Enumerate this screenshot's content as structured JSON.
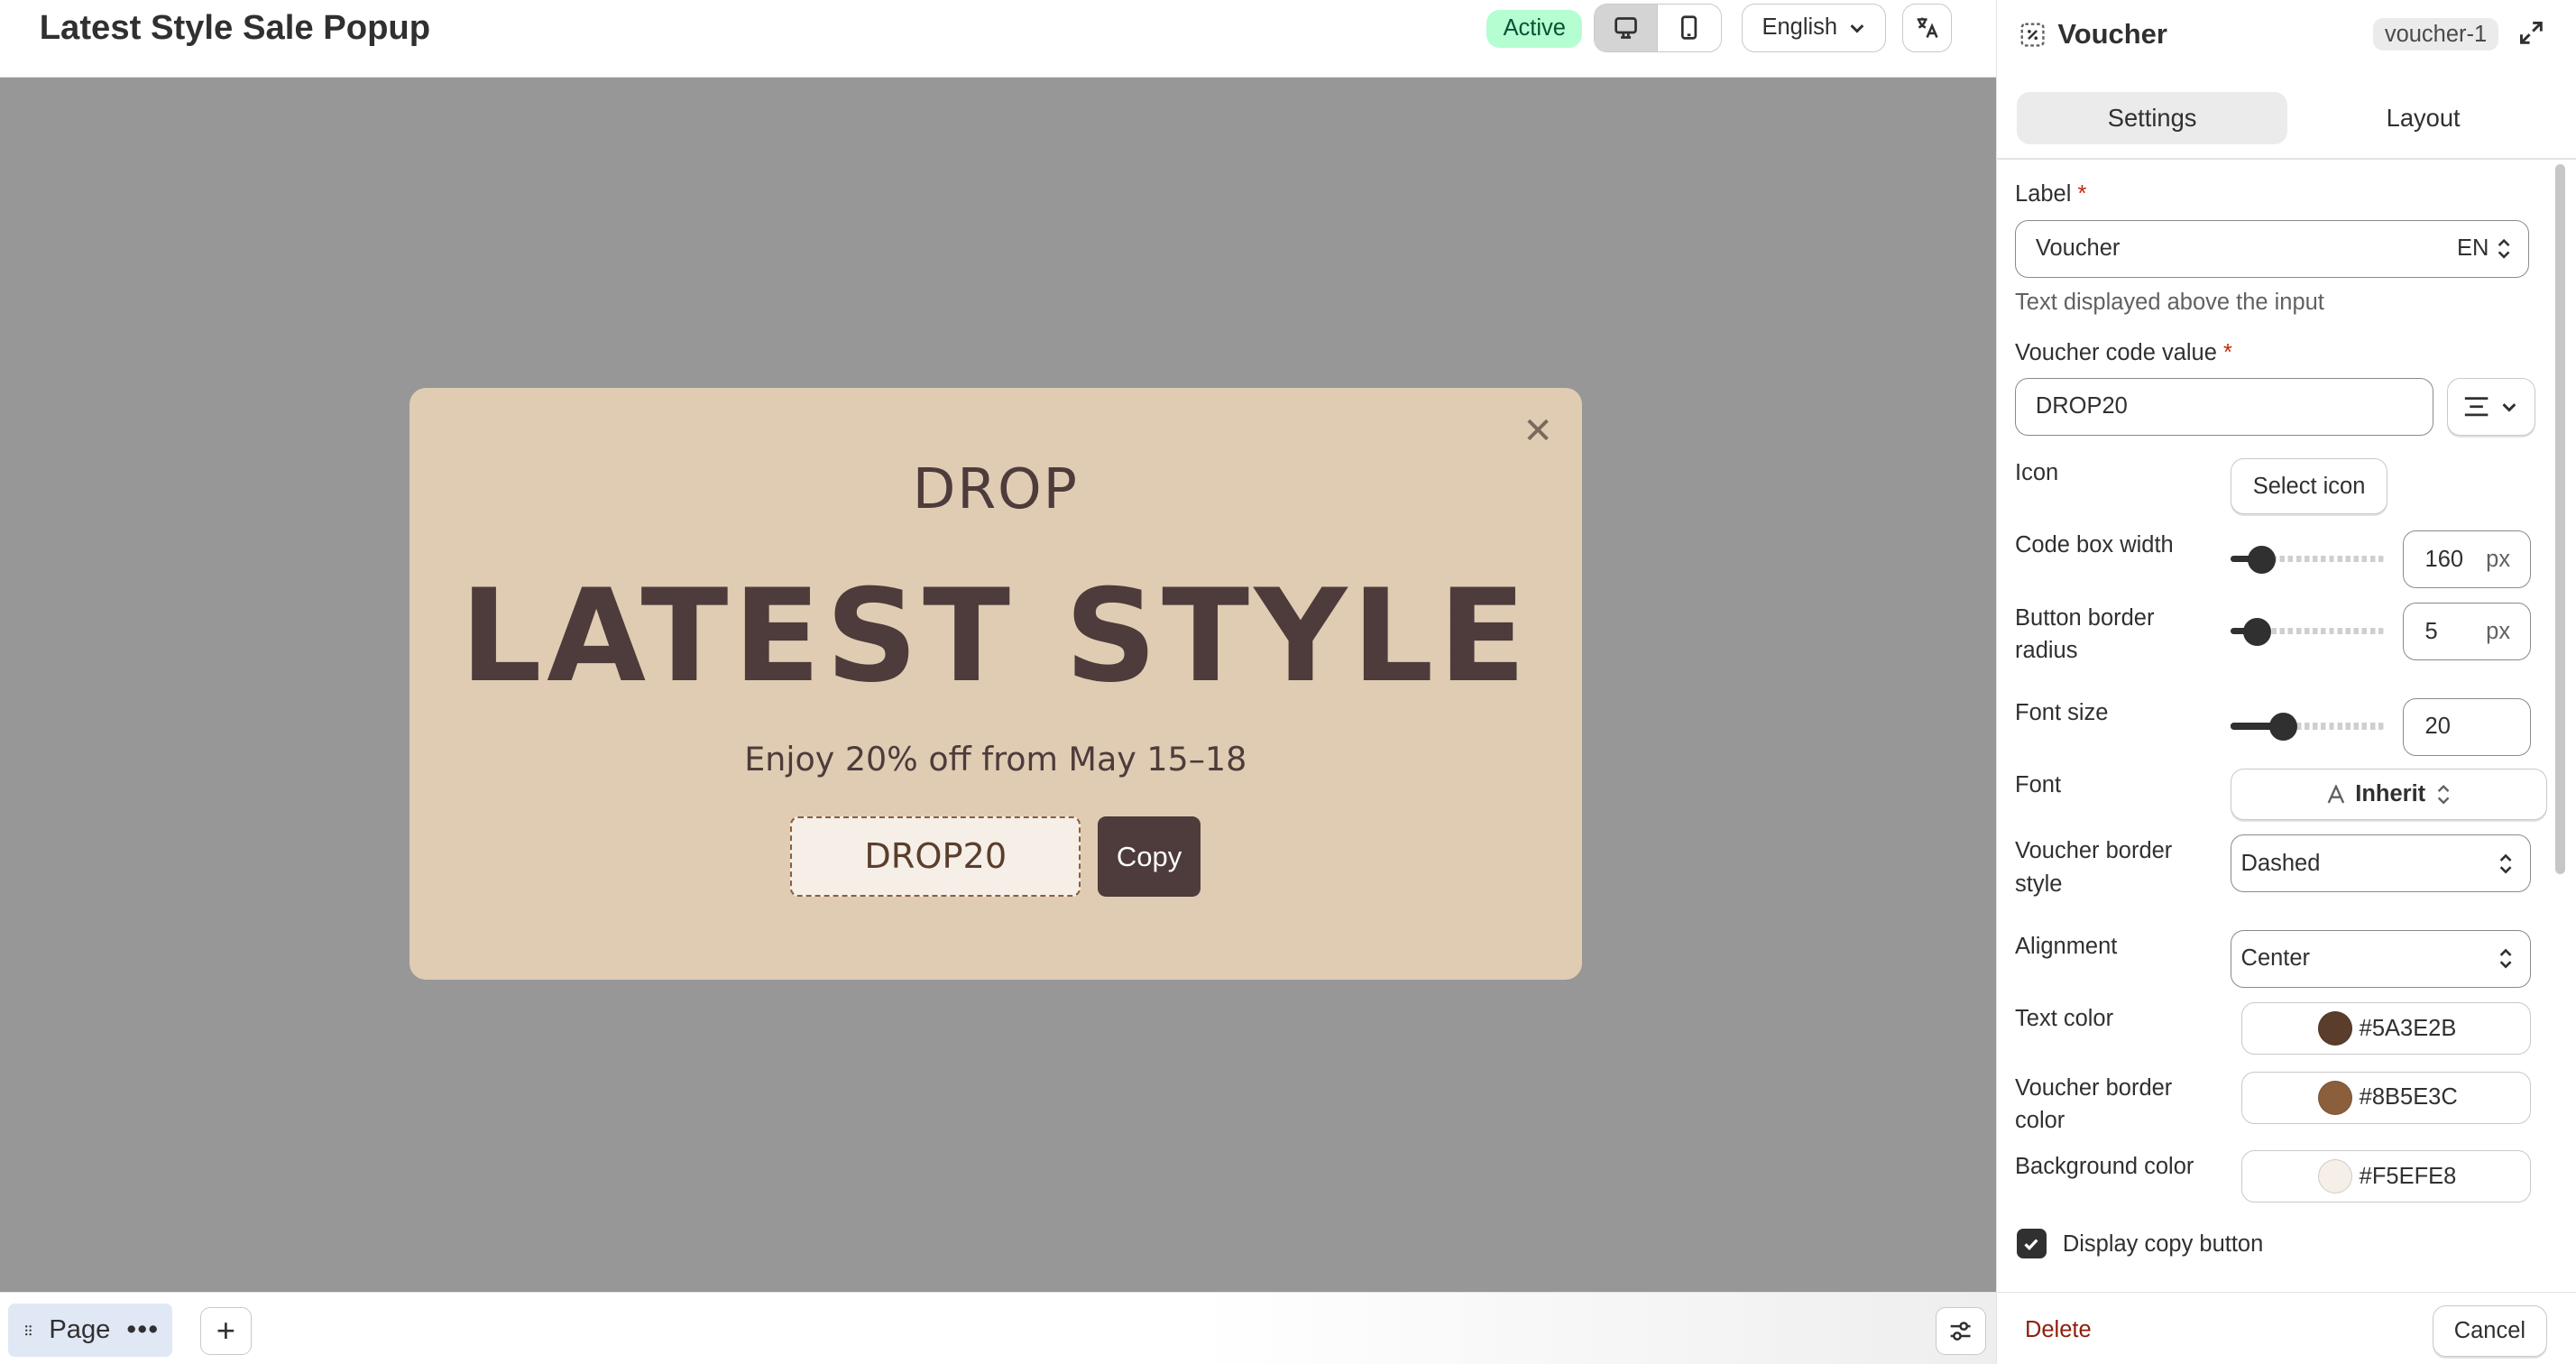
{
  "header": {
    "title": "Latest Style Sale Popup",
    "status": "Active",
    "language": "English"
  },
  "popup": {
    "eyebrow": "DROP",
    "headline": "LATEST STYLE",
    "subtext": "Enjoy 20% off from May 15–18",
    "voucher_code": "DROP20",
    "copy_label": "Copy",
    "close_glyph": "✕",
    "colors": {
      "background": "#DFCCB3",
      "text": "#4E3B3B"
    }
  },
  "bottombar": {
    "page_label": "Page",
    "more_glyph": "•••",
    "add_glyph": "+"
  },
  "panel": {
    "title": "Voucher",
    "element_id": "voucher-1",
    "tabs": [
      {
        "label": "Settings",
        "active": true
      },
      {
        "label": "Layout",
        "active": false
      }
    ],
    "label_field": {
      "label": "Label",
      "required_mark": "*",
      "value": "Voucher",
      "locale": "EN",
      "hint": "Text displayed above the input"
    },
    "code_field": {
      "label": "Voucher code value",
      "required_mark": "*",
      "value": "DROP20"
    },
    "icon": {
      "label": "Icon",
      "button": "Select icon"
    },
    "code_box_width": {
      "label": "Code box width",
      "value": "160",
      "unit": "px",
      "level": 0.2
    },
    "button_radius": {
      "label": "Button border radius",
      "value": "5",
      "unit": "px",
      "level": 0.17
    },
    "font_size": {
      "label": "Font size",
      "value": "20",
      "level": 0.34
    },
    "font": {
      "label": "Font",
      "value": "Inherit"
    },
    "border_style": {
      "label": "Voucher border style",
      "value": "Dashed"
    },
    "alignment": {
      "label": "Alignment",
      "value": "Center"
    },
    "text_color": {
      "label": "Text color",
      "value": "#5A3E2B"
    },
    "border_color": {
      "label": "Voucher border color",
      "value": "#8B5E3C"
    },
    "background_color": {
      "label": "Background color",
      "value": "#F5EFE8"
    },
    "copy_button": {
      "label": "Display copy button",
      "checked": true
    },
    "footer": {
      "delete": "Delete",
      "cancel": "Cancel"
    }
  }
}
